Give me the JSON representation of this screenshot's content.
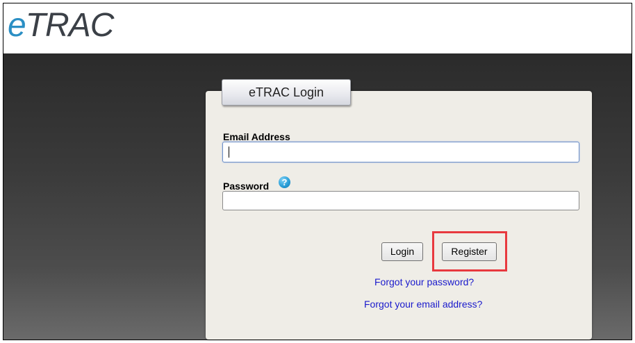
{
  "header": {
    "logo_prefix": "e",
    "logo_suffix": "TRAC"
  },
  "login": {
    "tab_title": "eTRAC Login",
    "email_label": "Email Address",
    "email_value": "",
    "password_label": "Password",
    "password_value": "",
    "help_glyph": "?",
    "login_button": "Login",
    "register_button": "Register",
    "forgot_password_link": "Forgot your password?",
    "forgot_email_link": "Forgot your email address?"
  },
  "colors": {
    "logo_e": "#2b8fc4",
    "logo_text": "#3b4047",
    "panel_bg": "#efede7",
    "highlight": "#e8393f",
    "link": "#1a1acc"
  },
  "icons": {
    "help": "help-question-icon"
  }
}
